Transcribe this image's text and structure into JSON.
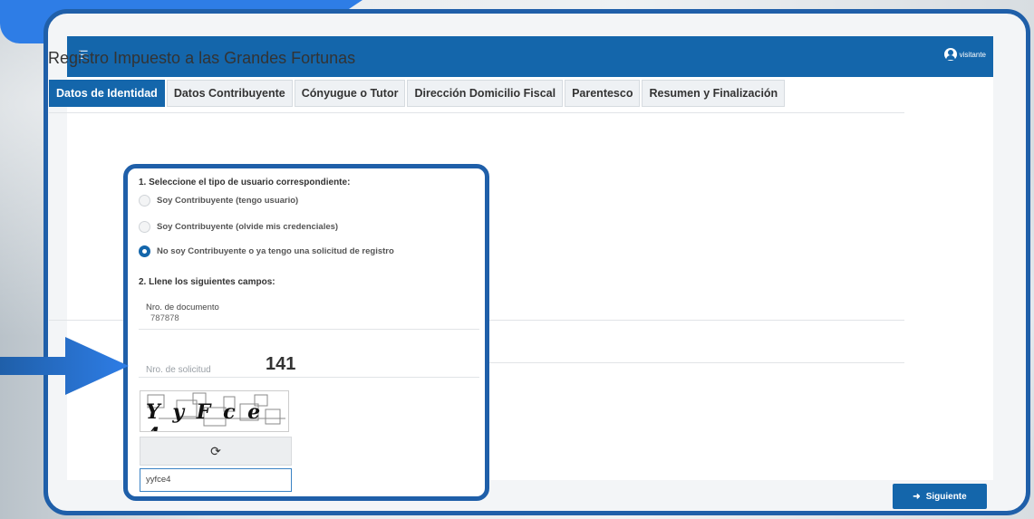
{
  "app": {
    "menu_icon": "hamburger-icon",
    "user_name": "visitante",
    "page_title": "Registro Impuesto a las Grandes Fortunas"
  },
  "tabs": [
    {
      "label": "Datos de Identidad",
      "active": true
    },
    {
      "label": "Datos Contribuyente",
      "active": false
    },
    {
      "label": "Cónyugue o Tutor",
      "active": false
    },
    {
      "label": "Dirección Domicilio Fiscal",
      "active": false
    },
    {
      "label": "Parentesco",
      "active": false
    },
    {
      "label": "Resumen y Finalización",
      "active": false
    }
  ],
  "form": {
    "section1_title": "1. Seleccione el tipo de usuario correspondiente:",
    "options": [
      {
        "label": "Soy Contribuyente (tengo usuario)",
        "checked": false
      },
      {
        "label": "Soy Contribuyente (olvide mis credenciales)",
        "checked": false
      },
      {
        "label": "No soy Contribuyente o ya tengo una solicitud de registro",
        "checked": true
      }
    ],
    "section2_title": "2. Llene los siguientes campos:",
    "doc_label": "Nro. de documento",
    "doc_value": "787878",
    "solicitud_placeholder": "Nro. de solicitud",
    "solicitud_overlay": "141",
    "captcha_text": "Y y F c e 4",
    "captcha_input": "yyfce4"
  },
  "footer": {
    "next_label": "Siguiente"
  },
  "colors": {
    "primary": "#1466ab",
    "frame": "#1f5fa9",
    "accent_blob": "#2e7de6"
  }
}
